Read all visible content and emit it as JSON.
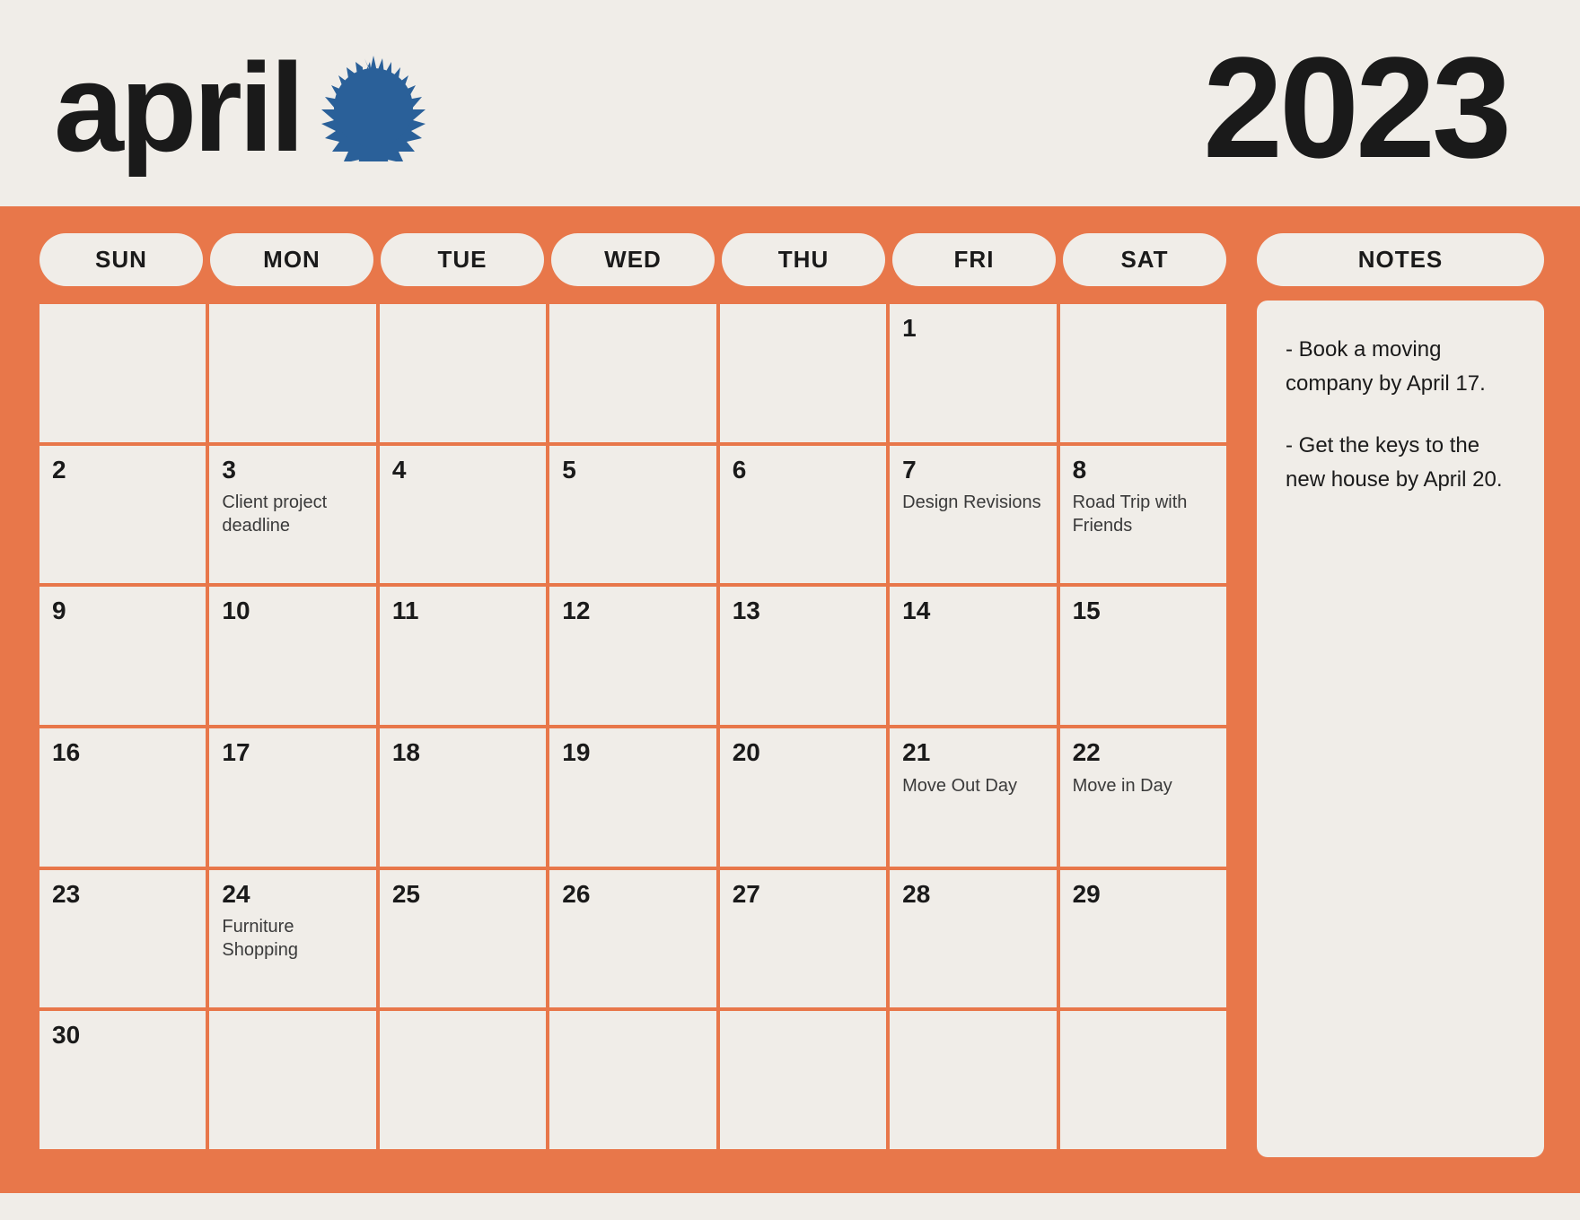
{
  "header": {
    "month": "april",
    "year": "2023",
    "accent_color": "#2a6099"
  },
  "day_headers": [
    "SUN",
    "MON",
    "TUE",
    "WED",
    "THU",
    "FRI",
    "SAT"
  ],
  "calendar": {
    "weeks": [
      [
        {
          "day": "",
          "event": ""
        },
        {
          "day": "",
          "event": ""
        },
        {
          "day": "",
          "event": ""
        },
        {
          "day": "",
          "event": ""
        },
        {
          "day": "",
          "event": ""
        },
        {
          "day": "1",
          "event": ""
        },
        {
          "day": "",
          "event": ""
        }
      ],
      [
        {
          "day": "2",
          "event": ""
        },
        {
          "day": "3",
          "event": "Client project deadline"
        },
        {
          "day": "4",
          "event": ""
        },
        {
          "day": "5",
          "event": ""
        },
        {
          "day": "6",
          "event": ""
        },
        {
          "day": "7",
          "event": "Design Revisions"
        },
        {
          "day": "8",
          "event": "Road Trip with Friends"
        }
      ],
      [
        {
          "day": "9",
          "event": ""
        },
        {
          "day": "10",
          "event": ""
        },
        {
          "day": "11",
          "event": ""
        },
        {
          "day": "12",
          "event": ""
        },
        {
          "day": "13",
          "event": ""
        },
        {
          "day": "14",
          "event": ""
        },
        {
          "day": "15",
          "event": ""
        }
      ],
      [
        {
          "day": "16",
          "event": ""
        },
        {
          "day": "17",
          "event": ""
        },
        {
          "day": "18",
          "event": ""
        },
        {
          "day": "19",
          "event": ""
        },
        {
          "day": "20",
          "event": ""
        },
        {
          "day": "21",
          "event": "Move Out Day"
        },
        {
          "day": "22",
          "event": "Move in Day"
        }
      ],
      [
        {
          "day": "23",
          "event": ""
        },
        {
          "day": "24",
          "event": "Furniture Shopping"
        },
        {
          "day": "25",
          "event": ""
        },
        {
          "day": "26",
          "event": ""
        },
        {
          "day": "27",
          "event": ""
        },
        {
          "day": "28",
          "event": ""
        },
        {
          "day": "29",
          "event": ""
        }
      ],
      [
        {
          "day": "30",
          "event": ""
        },
        {
          "day": "",
          "event": ""
        },
        {
          "day": "",
          "event": ""
        },
        {
          "day": "",
          "event": ""
        },
        {
          "day": "",
          "event": ""
        },
        {
          "day": "",
          "event": ""
        },
        {
          "day": "",
          "event": ""
        }
      ]
    ]
  },
  "notes": {
    "header": "NOTES",
    "items": [
      "- Book a moving company by April 17.",
      "- Get the keys to the new house by April 20."
    ]
  }
}
